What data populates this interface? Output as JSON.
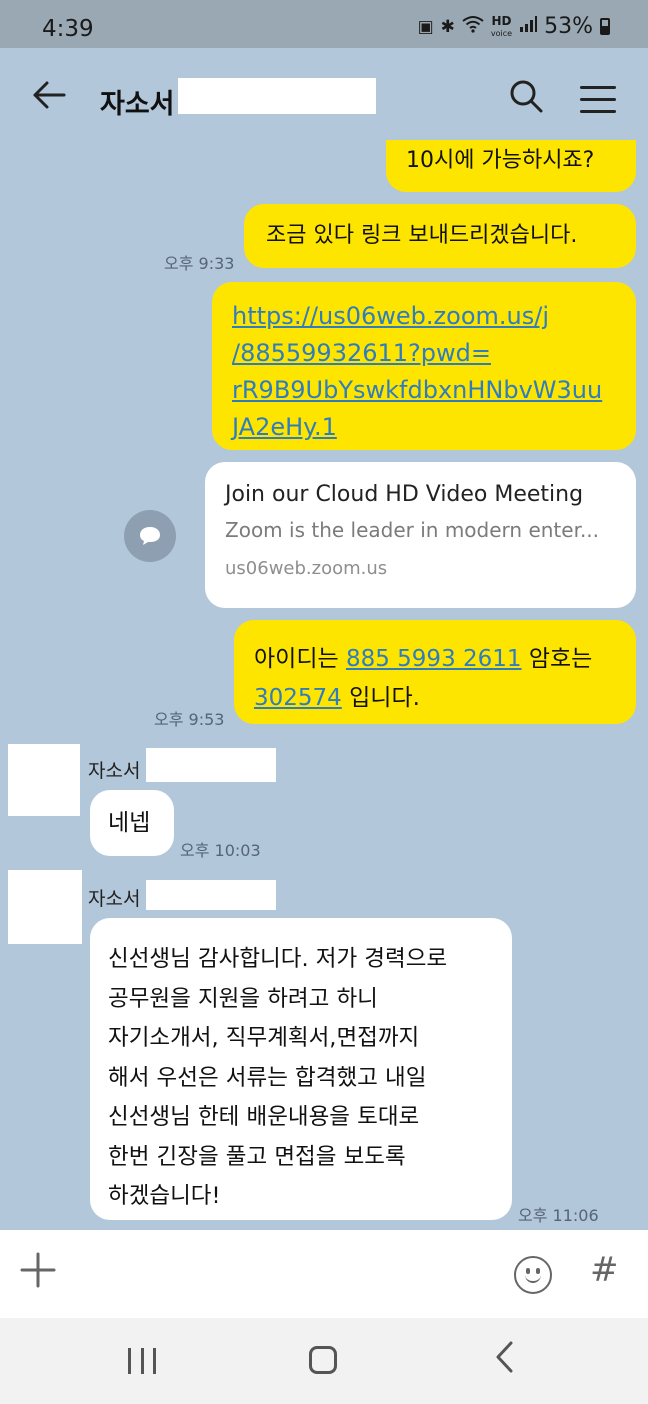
{
  "status": {
    "time": "4:39",
    "battery": "53%",
    "icons": [
      "nfc-icon",
      "bluetooth-icon",
      "wifi-icon",
      "hd-voice-icon",
      "signal-icon",
      "battery-icon"
    ]
  },
  "header": {
    "title": "자소서"
  },
  "messages": {
    "m1": "10시에 가능하시죠?",
    "m2": "조금 있다 링크 보내드리겠습니다.",
    "t2": "오후 9:33",
    "link_lines": [
      "https://us06web.zoom.us/j",
      "/88559932611?pwd=",
      "rR9B9UbYswkfdbxnHNbvW3uu",
      "JA2eHy.1"
    ],
    "preview": {
      "title": "Join our Cloud HD Video Meeting",
      "desc": "Zoom is the leader in modern enter...",
      "url": "us06web.zoom.us"
    },
    "m4": {
      "a": "아이디는 ",
      "id": "885 5993 2611",
      "b": " 암호는",
      "pw": "302574",
      "c": " 입니다."
    },
    "t4": "오후 9:53",
    "sender1": "자소서",
    "m5": "네넵",
    "t5": "오후 10:03",
    "sender2": "자소서",
    "m6_lines": [
      "신선생님 감사합니다. 저가 경력으로",
      "공무원을 지원을 하려고 하니",
      "자기소개서, 직무계획서,면접까지",
      "해서 우선은 서류는 합격했고 내일",
      "신선생님 한테 배운내용을 토대로",
      "한번 긴장을 풀고 면접을 보도록",
      "하겠습니다!"
    ],
    "t6": "오후 11:06"
  }
}
